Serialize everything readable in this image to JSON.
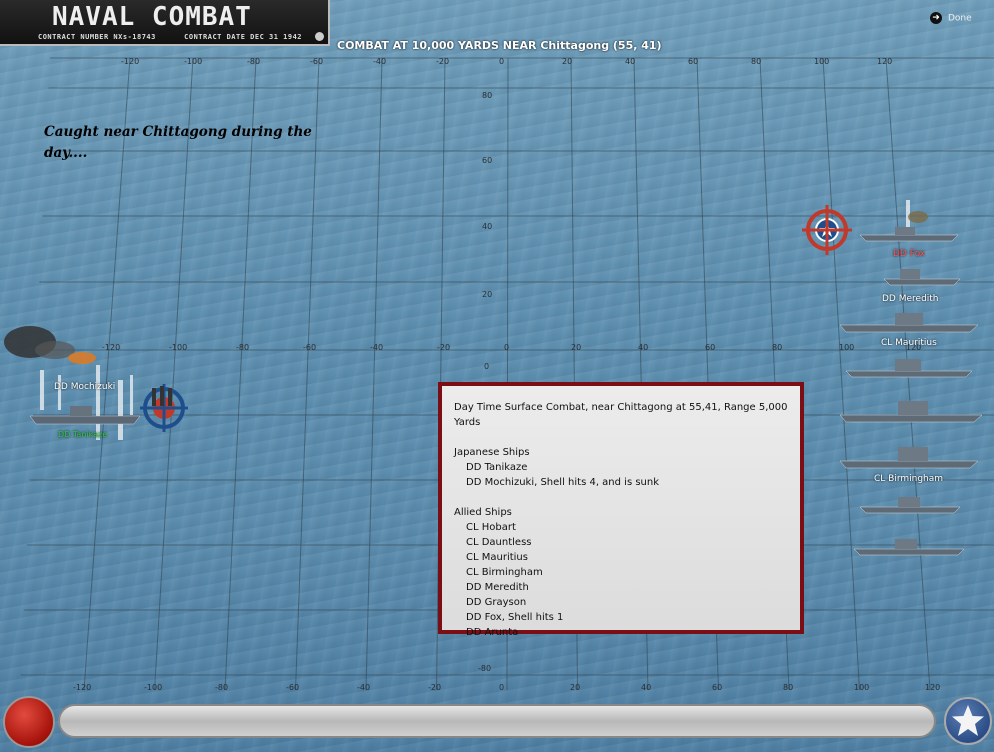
{
  "logo": {
    "title": "NAVAL COMBAT",
    "contract_number": "CONTRACT NUMBER  NXs-18743",
    "contract_date": "CONTRACT DATE  DEC 31 1942"
  },
  "combat_title": "COMBAT AT 10,000 YARDS NEAR Chittagong (55, 41)",
  "done_label": "Done",
  "caption": "Caught near Chittagong during the day....",
  "grid": {
    "top_x_labels": [
      "-120",
      "-100",
      "-80",
      "-60",
      "-40",
      "-20",
      "0",
      "20",
      "40",
      "60",
      "80",
      "100",
      "120"
    ],
    "mid_x_labels": [
      "-120",
      "-100",
      "-80",
      "-60",
      "-40",
      "-20",
      "0",
      "20",
      "40",
      "60",
      "80",
      "100",
      "120"
    ],
    "bottom_x_labels": [
      "-120",
      "-100",
      "-80",
      "-60",
      "-40",
      "-20",
      "0",
      "20",
      "40",
      "60",
      "80",
      "100",
      "120"
    ],
    "y_labels": [
      "80",
      "60",
      "40",
      "20",
      "0",
      "-20",
      "-40",
      "-60",
      "-80"
    ]
  },
  "ships": {
    "japanese_label": "DD Mochizuki",
    "japanese_tag": "DD Tanikaze",
    "allied_labels": {
      "fox": "DD Fox",
      "meredith": "DD Meredith",
      "mauritius": "CL Mauritius",
      "birmingham": "CL Birmingham"
    }
  },
  "report": {
    "header": "Day Time Surface Combat, near Chittagong at 55,41, Range 5,000 Yards",
    "japanese_heading": "Japanese Ships",
    "japanese": [
      "DD Tanikaze",
      "DD Mochizuki, Shell hits 4, and is sunk"
    ],
    "allied_heading": "Allied Ships",
    "allied": [
      "CL Hobart",
      "CL Dauntless",
      "CL Mauritius",
      "CL Birmingham",
      "DD Meredith",
      "DD Grayson",
      "DD Fox, Shell hits 1",
      "DD Arunta"
    ]
  },
  "colors": {
    "report_border": "#7a0e14",
    "grid_line": "#2f3f4a",
    "damage_label": "#ff5050",
    "japanese_tag": "#2ecc40"
  }
}
